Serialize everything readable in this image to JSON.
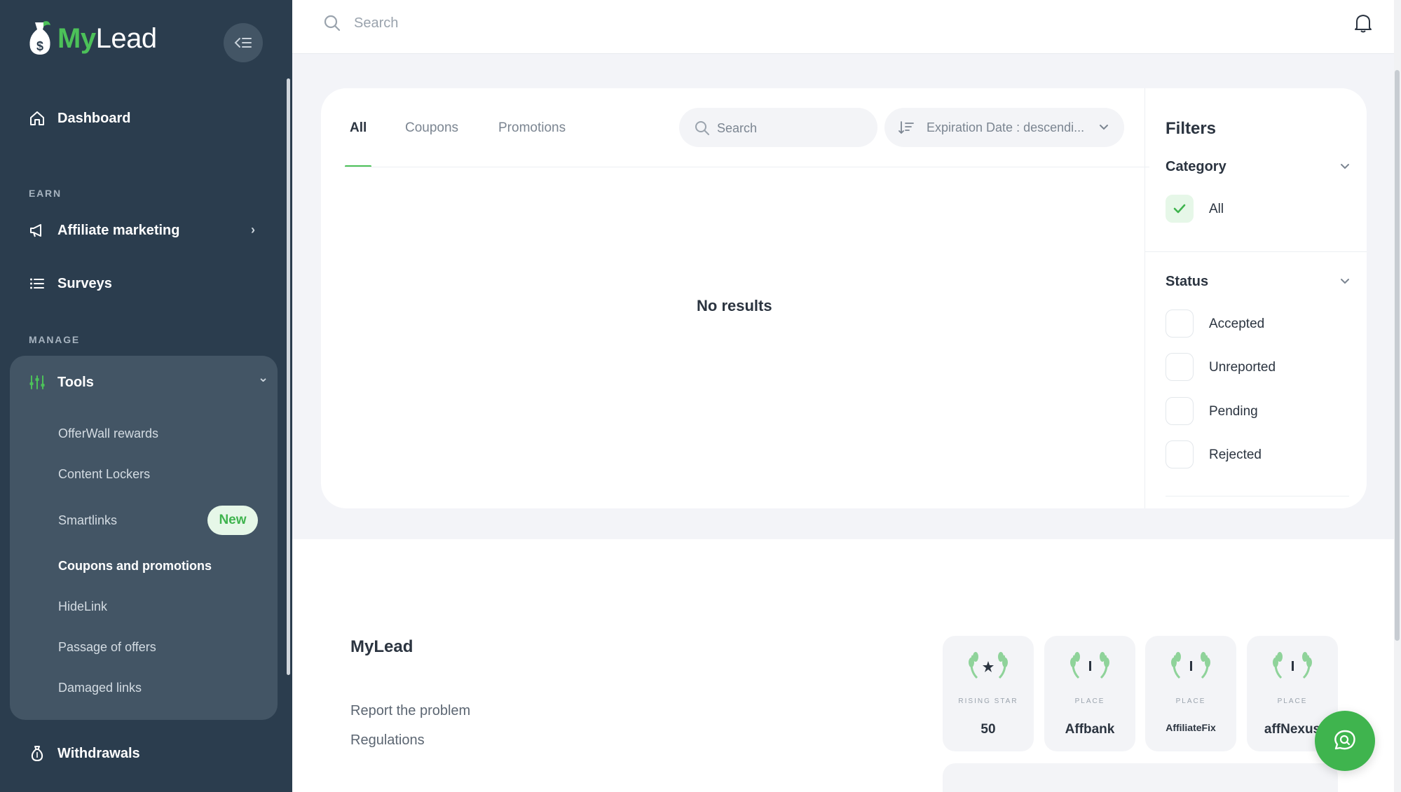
{
  "logo": {
    "my": "My",
    "lead": "Lead"
  },
  "topbar": {
    "search_placeholder": "Search"
  },
  "sidebar": {
    "dashboard": "Dashboard",
    "section_earn": "EARN",
    "affiliate_marketing": "Affiliate marketing",
    "surveys": "Surveys",
    "section_manage": "MANAGE",
    "tools": "Tools",
    "tools_items": [
      {
        "label": "OfferWall rewards"
      },
      {
        "label": "Content Lockers"
      },
      {
        "label": "Smartlinks",
        "badge": "New"
      },
      {
        "label": "Coupons and promotions",
        "active": true
      },
      {
        "label": "HideLink"
      },
      {
        "label": "Passage of offers"
      },
      {
        "label": "Damaged links"
      }
    ],
    "withdrawals": "Withdrawals"
  },
  "main": {
    "tabs": [
      {
        "label": "All",
        "active": true
      },
      {
        "label": "Coupons"
      },
      {
        "label": "Promotions"
      }
    ],
    "search_placeholder": "Search",
    "sort_label": "Expiration Date : descendi...",
    "no_results": "No results"
  },
  "filters": {
    "title": "Filters",
    "category": {
      "title": "Category",
      "options": [
        {
          "label": "All",
          "checked": true
        }
      ]
    },
    "status": {
      "title": "Status",
      "options": [
        {
          "label": "Accepted",
          "checked": false
        },
        {
          "label": "Unreported",
          "checked": false
        },
        {
          "label": "Pending",
          "checked": false
        },
        {
          "label": "Rejected",
          "checked": false
        }
      ]
    }
  },
  "footer": {
    "brand": "MyLead",
    "links": [
      "Report the problem",
      "Regulations"
    ],
    "awards": [
      {
        "label": "RISING STAR",
        "brand": "50"
      },
      {
        "label": "PLACE",
        "brand": "Affbank"
      },
      {
        "label": "PLACE",
        "brand": "AffiliateFix"
      },
      {
        "label": "PLACE",
        "brand": "affNexus"
      }
    ]
  },
  "colors": {
    "sidebar_bg": "#2b3d4e",
    "accent": "#4cc159",
    "card_bg": "#ffffff",
    "page_bg": "#f3f4f8"
  }
}
